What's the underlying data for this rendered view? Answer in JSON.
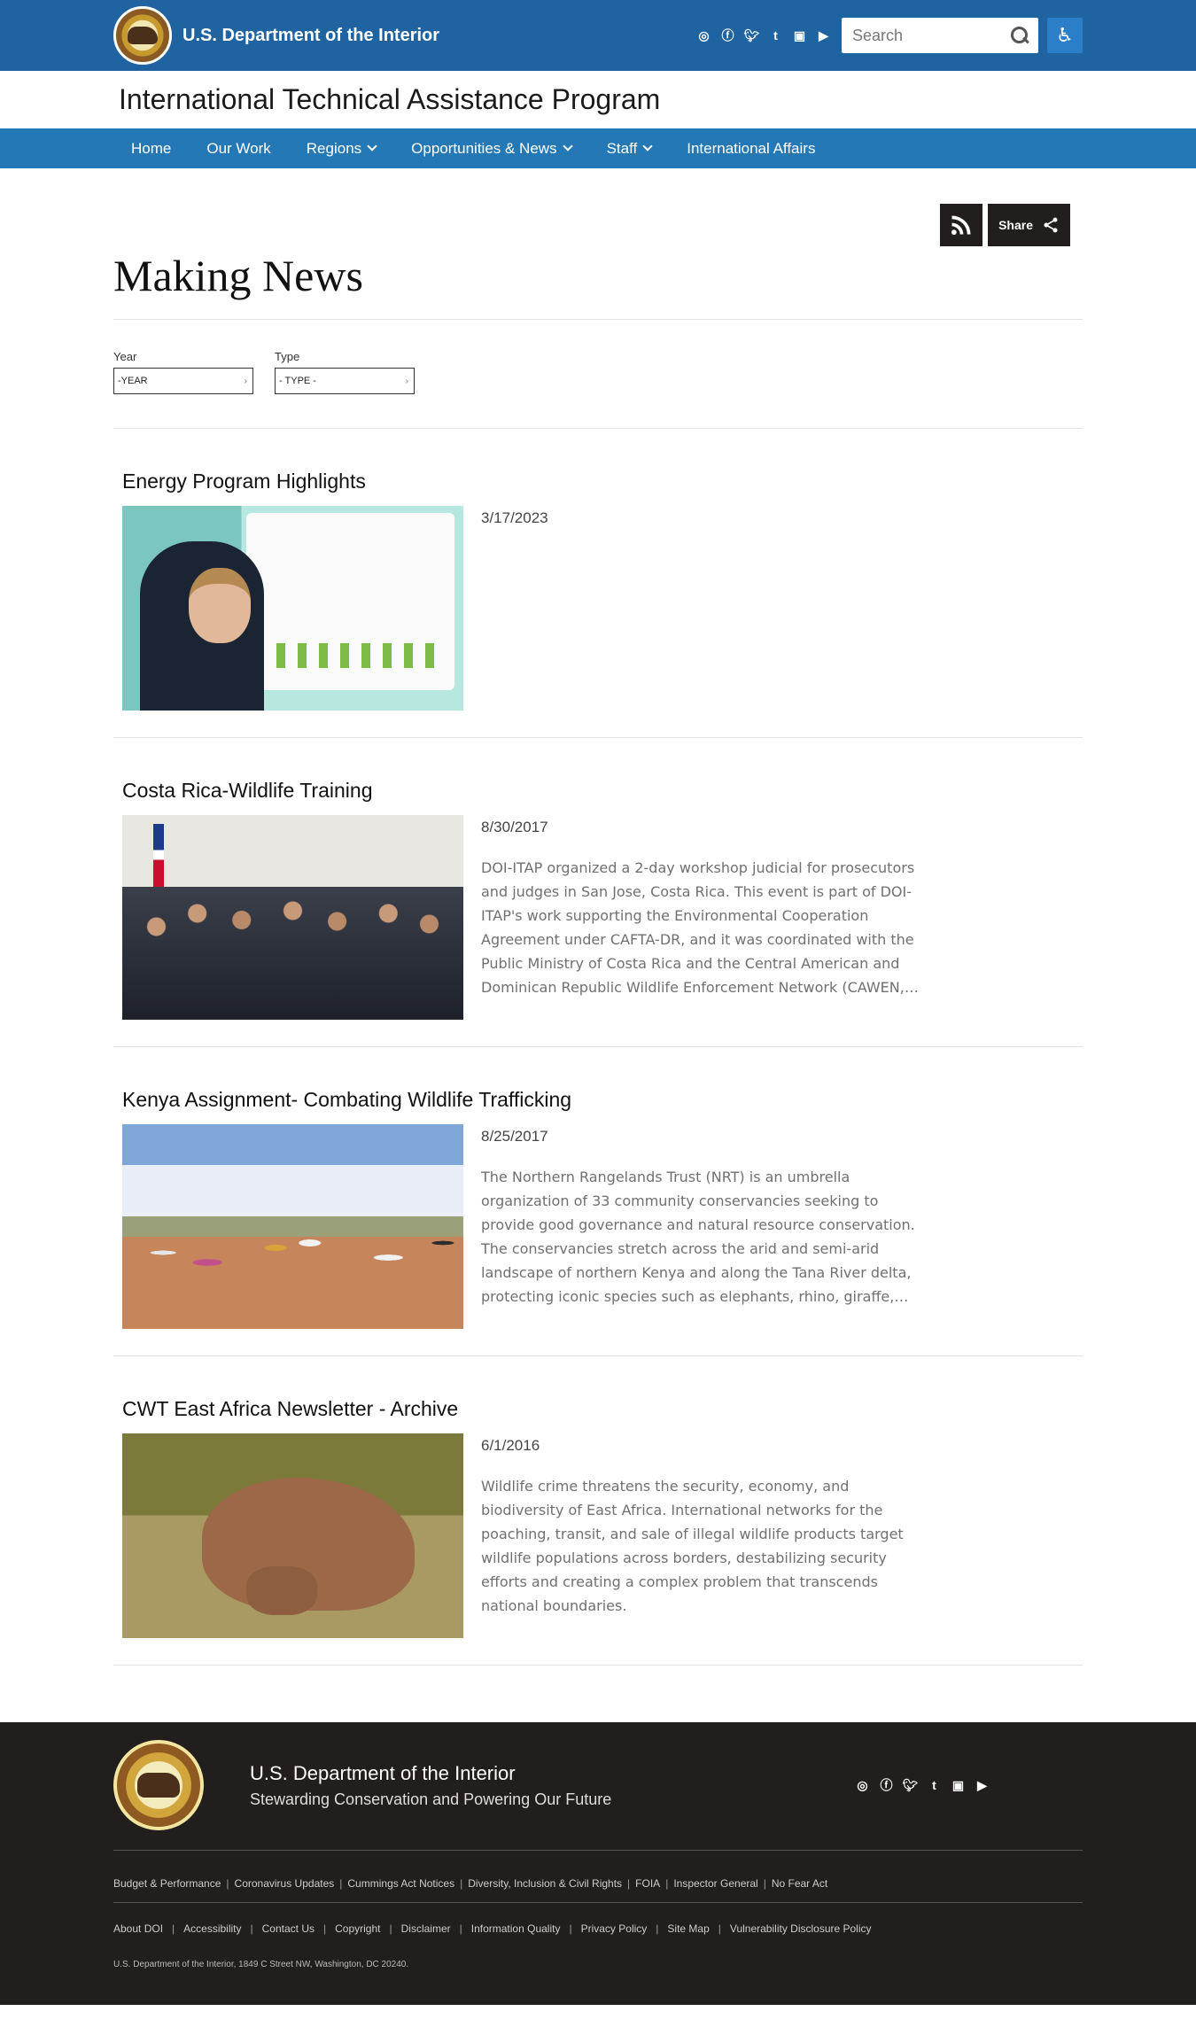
{
  "header": {
    "agency": "U.S. Department of the Interior",
    "social_icons": [
      "instagram-icon",
      "facebook-icon",
      "twitter-icon",
      "tumblr-icon",
      "flickr-icon",
      "youtube-icon"
    ],
    "search_placeholder": "Search"
  },
  "program_title": "International Technical Assistance Program",
  "nav": {
    "items": [
      {
        "label": "Home",
        "has_dropdown": false
      },
      {
        "label": "Our Work",
        "has_dropdown": false
      },
      {
        "label": "Regions",
        "has_dropdown": true
      },
      {
        "label": "Opportunities & News",
        "has_dropdown": true
      },
      {
        "label": "Staff",
        "has_dropdown": true
      },
      {
        "label": "International Affairs",
        "has_dropdown": false
      }
    ]
  },
  "toolbar": {
    "share_label": "Share"
  },
  "page_title": "Making News",
  "filters": {
    "year_label": "Year",
    "year_value": "-YEAR",
    "type_label": "Type",
    "type_value": "- TYPE -"
  },
  "items": [
    {
      "title": "Energy Program Highlights",
      "date": "3/17/2023",
      "description": ""
    },
    {
      "title": "Costa Rica-Wildlife Training",
      "date": "8/30/2017",
      "description": "DOI-ITAP organized a 2-day workshop judicial for prosecutors and judges in San Jose, Costa Rica.  This event is part of DOI-ITAP's work supporting the Environmental Cooperation Agreement under CAFTA-DR, and it was coordinated with the Public Ministry of Costa Rica and the Central American and Dominican Republic Wildlife Enforcement Network (CAWEN,…"
    },
    {
      "title": "Kenya Assignment- Combating Wildlife Trafficking",
      "date": "8/25/2017",
      "description": "The Northern Rangelands Trust (NRT) is an umbrella organization of 33 community conservancies seeking to provide good governance and natural resource conservation. The conservancies stretch across the arid and semi-arid landscape of northern Kenya and along the Tana River delta, protecting iconic species such as elephants, rhino, giraffe,…"
    },
    {
      "title": "CWT East Africa Newsletter - Archive",
      "date": "6/1/2016",
      "description": "Wildlife crime threatens the security, economy, and biodiversity of East Africa. International networks for the poaching, transit, and sale of illegal wildlife products target wildlife populations across borders, destabilizing security efforts and creating a complex problem that transcends national boundaries."
    }
  ],
  "footer": {
    "name": "U.S. Department of the Interior",
    "tagline": "Stewarding Conservation and Powering Our Future",
    "links1": [
      "Budget & Performance",
      "Coronavirus Updates",
      "Cummings Act Notices",
      "Diversity, Inclusion & Civil Rights",
      "FOIA",
      "Inspector General",
      "No Fear Act"
    ],
    "links2": [
      "About DOI",
      "Accessibility",
      "Contact Us",
      "Copyright",
      "Disclaimer",
      "Information Quality",
      "Privacy Policy",
      "Site Map",
      "Vulnerability Disclosure Policy"
    ],
    "address": "U.S. Department of the Interior, 1849 C Street NW, Washington, DC 20240."
  },
  "colors": {
    "header_bg": "#1f63a0",
    "nav_bg": "#2578b6",
    "footer_bg": "#231e1e"
  }
}
